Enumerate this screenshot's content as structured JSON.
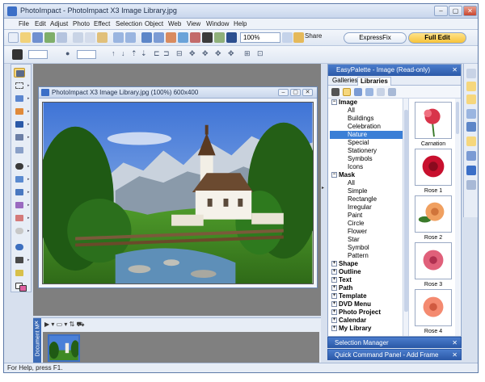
{
  "window": {
    "title": "PhotoImpact - PhotoImpact X3 Image Library.jpg",
    "buttons": [
      "–",
      "▢",
      "✕"
    ]
  },
  "menu": [
    "File",
    "Edit",
    "Adjust",
    "Photo",
    "Effect",
    "Selection",
    "Object",
    "Web",
    "View",
    "Window",
    "Help"
  ],
  "toolbar": {
    "zoom_value": "100%",
    "share_label": "Share",
    "mode_tabs": [
      "ExpressFix",
      "Full Edit"
    ],
    "active_mode": "Full Edit"
  },
  "document": {
    "title": "PhotoImpact X3 Image Library.jpg (100%) 600x400",
    "buttons": [
      "–",
      "▢",
      "✕"
    ]
  },
  "easypalette": {
    "title": "EasyPalette - Image (Read-only)",
    "close": "✕",
    "tabs": [
      "Galleries",
      "Libraries"
    ],
    "active_tab": "Libraries",
    "tree": [
      {
        "label": "Image",
        "header": true,
        "toggle": "−"
      },
      {
        "label": "All"
      },
      {
        "label": "Buildings"
      },
      {
        "label": "Celebration"
      },
      {
        "label": "Nature",
        "selected": true
      },
      {
        "label": "Special"
      },
      {
        "label": "Stationery"
      },
      {
        "label": "Symbols"
      },
      {
        "label": "Icons"
      },
      {
        "label": "Mask",
        "header": true,
        "toggle": "−"
      },
      {
        "label": "All"
      },
      {
        "label": "Simple"
      },
      {
        "label": "Rectangle"
      },
      {
        "label": "Irregular"
      },
      {
        "label": "Paint"
      },
      {
        "label": "Circle"
      },
      {
        "label": "Flower"
      },
      {
        "label": "Star"
      },
      {
        "label": "Symbol"
      },
      {
        "label": "Pattern"
      },
      {
        "label": "Shape",
        "header": true,
        "toggle": "+"
      },
      {
        "label": "Outline",
        "header": true,
        "toggle": "+"
      },
      {
        "label": "Text",
        "header": true,
        "toggle": "+"
      },
      {
        "label": "Path",
        "header": true,
        "toggle": "+"
      },
      {
        "label": "Template",
        "header": true,
        "toggle": "+"
      },
      {
        "label": "DVD Menu",
        "header": true,
        "toggle": "+"
      },
      {
        "label": "Photo Project",
        "header": true,
        "toggle": "+"
      },
      {
        "label": "Calendar",
        "header": true,
        "toggle": "+"
      },
      {
        "label": "My Library",
        "header": true,
        "toggle": "+"
      }
    ],
    "gallery": [
      {
        "label": "Carnation",
        "color": "#d8344a"
      },
      {
        "label": "Rose 1",
        "color": "#c8102e"
      },
      {
        "label": "Rose 2",
        "color": "#f0a060"
      },
      {
        "label": "Rose 3",
        "color": "#e0607a"
      },
      {
        "label": "Rose 4",
        "color": "#f48a70"
      }
    ]
  },
  "subpanels": [
    {
      "title": "Selection Manager",
      "close": "✕"
    },
    {
      "title": "Quick Command Panel - Add Frame",
      "close": "✕"
    }
  ],
  "filmstrip": {
    "label": "Document M",
    "close": "✕",
    "tools": "▶ ▾ ▭ ▾ ⇅ ⛟"
  },
  "status": {
    "text": "For Help, press F1."
  },
  "colors": {
    "accent": "#3b6fc7",
    "selected": "#3b7fd6",
    "active_mode": "#f7c33a"
  }
}
